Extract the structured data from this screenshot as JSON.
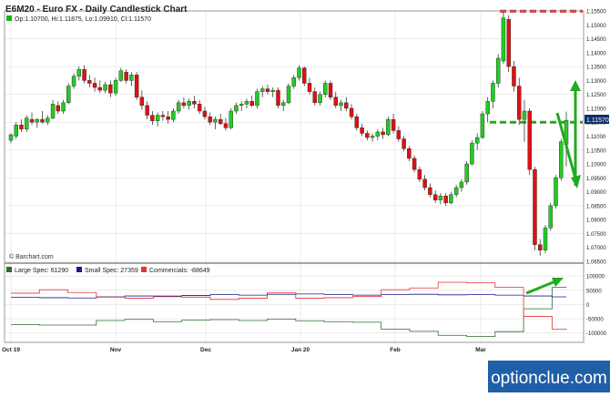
{
  "title": "E6M20 - Euro FX - Daily Candlestick Chart",
  "ohlc": {
    "label": "Op:1.10700, Hi:1.11875, Lo:1.09910, Cl:1.11570",
    "color": "#1db11d"
  },
  "watermark": "© Barchart.com",
  "brand": "optionclue.com",
  "price_tag": "1.11570",
  "colors": {
    "up": "#22cc22",
    "down": "#dd1111",
    "arrow": "#22aa22",
    "large_spec": "#2e6b2e",
    "small_spec": "#1a1a8c",
    "commercials": "#e23333",
    "grid": "#d8d8d8",
    "brand_bg": "#1f5fa8",
    "price_tag_bg": "#0e2f6a"
  },
  "icons": [
    "green-square-icon",
    "navy-square-icon",
    "red-square-icon"
  ],
  "chart_data": [
    {
      "type": "candlestick",
      "title": "E6M20 - Euro FX - Daily Candlestick Chart",
      "x_ticks": [
        "Oct 19",
        "Nov",
        "Dec",
        "Jan 20",
        "Feb",
        "Mar"
      ],
      "ylim": [
        1.065,
        1.155
      ],
      "y_ticks": [
        "1.15500",
        "1.15000",
        "1.14500",
        "1.14000",
        "1.13500",
        "1.13000",
        "1.12500",
        "1.12000",
        "1.11500",
        "1.11000",
        "1.10500",
        "1.10000",
        "1.09500",
        "1.09000",
        "1.08500",
        "1.08000",
        "1.07500",
        "1.07000",
        "1.06500"
      ],
      "reference_lines": [
        {
          "level": 1.1549,
          "style": "dashed",
          "color": "#dd1111"
        },
        {
          "level": 1.115,
          "style": "dashed",
          "color": "#22aa22"
        }
      ],
      "candles": [
        {
          "o": 1.1085,
          "h": 1.111,
          "l": 1.1075,
          "c": 1.1105
        },
        {
          "o": 1.11,
          "h": 1.115,
          "l": 1.109,
          "c": 1.114
        },
        {
          "o": 1.114,
          "h": 1.116,
          "l": 1.1115,
          "c": 1.1125
        },
        {
          "o": 1.1125,
          "h": 1.1175,
          "l": 1.1115,
          "c": 1.1165
        },
        {
          "o": 1.116,
          "h": 1.1185,
          "l": 1.114,
          "c": 1.115
        },
        {
          "o": 1.115,
          "h": 1.1165,
          "l": 1.113,
          "c": 1.116
        },
        {
          "o": 1.116,
          "h": 1.119,
          "l": 1.1145,
          "c": 1.115
        },
        {
          "o": 1.115,
          "h": 1.1175,
          "l": 1.114,
          "c": 1.1165
        },
        {
          "o": 1.1165,
          "h": 1.123,
          "l": 1.116,
          "c": 1.1215
        },
        {
          "o": 1.121,
          "h": 1.1225,
          "l": 1.118,
          "c": 1.119
        },
        {
          "o": 1.119,
          "h": 1.123,
          "l": 1.118,
          "c": 1.122
        },
        {
          "o": 1.122,
          "h": 1.129,
          "l": 1.1215,
          "c": 1.128
        },
        {
          "o": 1.128,
          "h": 1.1325,
          "l": 1.127,
          "c": 1.1315
        },
        {
          "o": 1.1315,
          "h": 1.135,
          "l": 1.13,
          "c": 1.134
        },
        {
          "o": 1.134,
          "h": 1.1355,
          "l": 1.129,
          "c": 1.13
        },
        {
          "o": 1.13,
          "h": 1.132,
          "l": 1.1275,
          "c": 1.129
        },
        {
          "o": 1.129,
          "h": 1.131,
          "l": 1.126,
          "c": 1.1275
        },
        {
          "o": 1.1275,
          "h": 1.13,
          "l": 1.1255,
          "c": 1.1265
        },
        {
          "o": 1.1265,
          "h": 1.1295,
          "l": 1.1255,
          "c": 1.1285
        },
        {
          "o": 1.1285,
          "h": 1.13,
          "l": 1.124,
          "c": 1.1255
        },
        {
          "o": 1.1255,
          "h": 1.131,
          "l": 1.1245,
          "c": 1.13
        },
        {
          "o": 1.13,
          "h": 1.1345,
          "l": 1.1295,
          "c": 1.1335
        },
        {
          "o": 1.133,
          "h": 1.134,
          "l": 1.129,
          "c": 1.13
        },
        {
          "o": 1.13,
          "h": 1.133,
          "l": 1.128,
          "c": 1.132
        },
        {
          "o": 1.132,
          "h": 1.133,
          "l": 1.123,
          "c": 1.124
        },
        {
          "o": 1.124,
          "h": 1.1265,
          "l": 1.1195,
          "c": 1.121
        },
        {
          "o": 1.121,
          "h": 1.1225,
          "l": 1.116,
          "c": 1.1175
        },
        {
          "o": 1.1175,
          "h": 1.119,
          "l": 1.114,
          "c": 1.1155
        },
        {
          "o": 1.1155,
          "h": 1.1185,
          "l": 1.1135,
          "c": 1.1175
        },
        {
          "o": 1.1175,
          "h": 1.119,
          "l": 1.1155,
          "c": 1.117
        },
        {
          "o": 1.117,
          "h": 1.119,
          "l": 1.1145,
          "c": 1.116
        },
        {
          "o": 1.116,
          "h": 1.12,
          "l": 1.115,
          "c": 1.119
        },
        {
          "o": 1.119,
          "h": 1.123,
          "l": 1.118,
          "c": 1.122
        },
        {
          "o": 1.122,
          "h": 1.124,
          "l": 1.12,
          "c": 1.121
        },
        {
          "o": 1.121,
          "h": 1.1235,
          "l": 1.1195,
          "c": 1.1225
        },
        {
          "o": 1.1225,
          "h": 1.1245,
          "l": 1.12,
          "c": 1.1215
        },
        {
          "o": 1.1215,
          "h": 1.123,
          "l": 1.118,
          "c": 1.119
        },
        {
          "o": 1.119,
          "h": 1.1205,
          "l": 1.116,
          "c": 1.117
        },
        {
          "o": 1.117,
          "h": 1.1185,
          "l": 1.114,
          "c": 1.115
        },
        {
          "o": 1.115,
          "h": 1.117,
          "l": 1.1125,
          "c": 1.116
        },
        {
          "o": 1.116,
          "h": 1.118,
          "l": 1.114,
          "c": 1.1145
        },
        {
          "o": 1.1145,
          "h": 1.1165,
          "l": 1.112,
          "c": 1.113
        },
        {
          "o": 1.113,
          "h": 1.12,
          "l": 1.1125,
          "c": 1.119
        },
        {
          "o": 1.119,
          "h": 1.122,
          "l": 1.118,
          "c": 1.121
        },
        {
          "o": 1.121,
          "h": 1.1225,
          "l": 1.119,
          "c": 1.1215
        },
        {
          "o": 1.1215,
          "h": 1.1235,
          "l": 1.12,
          "c": 1.1225
        },
        {
          "o": 1.1225,
          "h": 1.1245,
          "l": 1.1205,
          "c": 1.121
        },
        {
          "o": 1.121,
          "h": 1.127,
          "l": 1.12,
          "c": 1.126
        },
        {
          "o": 1.126,
          "h": 1.128,
          "l": 1.124,
          "c": 1.127
        },
        {
          "o": 1.127,
          "h": 1.1285,
          "l": 1.125,
          "c": 1.126
        },
        {
          "o": 1.126,
          "h": 1.1275,
          "l": 1.124,
          "c": 1.1265
        },
        {
          "o": 1.1265,
          "h": 1.1275,
          "l": 1.12,
          "c": 1.121
        },
        {
          "o": 1.121,
          "h": 1.123,
          "l": 1.119,
          "c": 1.122
        },
        {
          "o": 1.122,
          "h": 1.129,
          "l": 1.1215,
          "c": 1.128
        },
        {
          "o": 1.128,
          "h": 1.132,
          "l": 1.127,
          "c": 1.131
        },
        {
          "o": 1.131,
          "h": 1.1355,
          "l": 1.13,
          "c": 1.1345
        },
        {
          "o": 1.1345,
          "h": 1.135,
          "l": 1.128,
          "c": 1.129
        },
        {
          "o": 1.129,
          "h": 1.131,
          "l": 1.125,
          "c": 1.126
        },
        {
          "o": 1.126,
          "h": 1.1275,
          "l": 1.121,
          "c": 1.122
        },
        {
          "o": 1.122,
          "h": 1.126,
          "l": 1.121,
          "c": 1.125
        },
        {
          "o": 1.125,
          "h": 1.13,
          "l": 1.124,
          "c": 1.129
        },
        {
          "o": 1.129,
          "h": 1.13,
          "l": 1.123,
          "c": 1.124
        },
        {
          "o": 1.124,
          "h": 1.126,
          "l": 1.12,
          "c": 1.121
        },
        {
          "o": 1.121,
          "h": 1.123,
          "l": 1.119,
          "c": 1.122
        },
        {
          "o": 1.122,
          "h": 1.124,
          "l": 1.119,
          "c": 1.12
        },
        {
          "o": 1.12,
          "h": 1.1215,
          "l": 1.116,
          "c": 1.117
        },
        {
          "o": 1.117,
          "h": 1.118,
          "l": 1.112,
          "c": 1.113
        },
        {
          "o": 1.113,
          "h": 1.1145,
          "l": 1.11,
          "c": 1.111
        },
        {
          "o": 1.111,
          "h": 1.112,
          "l": 1.1085,
          "c": 1.1095
        },
        {
          "o": 1.1095,
          "h": 1.111,
          "l": 1.108,
          "c": 1.11
        },
        {
          "o": 1.11,
          "h": 1.1125,
          "l": 1.1085,
          "c": 1.1115
        },
        {
          "o": 1.1115,
          "h": 1.113,
          "l": 1.109,
          "c": 1.1105
        },
        {
          "o": 1.1105,
          "h": 1.117,
          "l": 1.11,
          "c": 1.116
        },
        {
          "o": 1.116,
          "h": 1.118,
          "l": 1.111,
          "c": 1.112
        },
        {
          "o": 1.112,
          "h": 1.1135,
          "l": 1.108,
          "c": 1.109
        },
        {
          "o": 1.109,
          "h": 1.11,
          "l": 1.1045,
          "c": 1.1055
        },
        {
          "o": 1.1055,
          "h": 1.1065,
          "l": 1.101,
          "c": 1.102
        },
        {
          "o": 1.102,
          "h": 1.103,
          "l": 1.097,
          "c": 1.098
        },
        {
          "o": 1.098,
          "h": 1.099,
          "l": 1.0935,
          "c": 1.0945
        },
        {
          "o": 1.0945,
          "h": 1.096,
          "l": 1.0905,
          "c": 1.0915
        },
        {
          "o": 1.0915,
          "h": 1.093,
          "l": 1.088,
          "c": 1.089
        },
        {
          "o": 1.089,
          "h": 1.0905,
          "l": 1.086,
          "c": 1.087
        },
        {
          "o": 1.087,
          "h": 1.0895,
          "l": 1.0855,
          "c": 1.0885
        },
        {
          "o": 1.0885,
          "h": 1.0895,
          "l": 1.085,
          "c": 1.086
        },
        {
          "o": 1.086,
          "h": 1.09,
          "l": 1.0855,
          "c": 1.089
        },
        {
          "o": 1.089,
          "h": 1.0925,
          "l": 1.088,
          "c": 1.0915
        },
        {
          "o": 1.0915,
          "h": 1.0945,
          "l": 1.09,
          "c": 1.0935
        },
        {
          "o": 1.0935,
          "h": 1.101,
          "l": 1.0925,
          "c": 1.1
        },
        {
          "o": 1.1,
          "h": 1.1085,
          "l": 1.0995,
          "c": 1.1075
        },
        {
          "o": 1.1075,
          "h": 1.111,
          "l": 1.105,
          "c": 1.1095
        },
        {
          "o": 1.1095,
          "h": 1.119,
          "l": 1.109,
          "c": 1.118
        },
        {
          "o": 1.118,
          "h": 1.124,
          "l": 1.115,
          "c": 1.1225
        },
        {
          "o": 1.1225,
          "h": 1.13,
          "l": 1.12,
          "c": 1.129
        },
        {
          "o": 1.129,
          "h": 1.1395,
          "l": 1.1275,
          "c": 1.138
        },
        {
          "o": 1.137,
          "h": 1.155,
          "l": 1.136,
          "c": 1.1525
        },
        {
          "o": 1.152,
          "h": 1.1535,
          "l": 1.133,
          "c": 1.135
        },
        {
          "o": 1.135,
          "h": 1.137,
          "l": 1.126,
          "c": 1.128
        },
        {
          "o": 1.128,
          "h": 1.131,
          "l": 1.114,
          "c": 1.116
        },
        {
          "o": 1.116,
          "h": 1.123,
          "l": 1.108,
          "c": 1.119
        },
        {
          "o": 1.119,
          "h": 1.12,
          "l": 1.096,
          "c": 1.098
        },
        {
          "o": 1.098,
          "h": 1.099,
          "l": 1.069,
          "c": 1.071
        },
        {
          "o": 1.071,
          "h": 1.073,
          "l": 1.067,
          "c": 1.069
        },
        {
          "o": 1.069,
          "h": 1.078,
          "l": 1.068,
          "c": 1.077
        },
        {
          "o": 1.077,
          "h": 1.086,
          "l": 1.076,
          "c": 1.085
        },
        {
          "o": 1.085,
          "h": 1.096,
          "l": 1.084,
          "c": 1.095
        },
        {
          "o": 1.095,
          "h": 1.109,
          "l": 1.094,
          "c": 1.108
        },
        {
          "o": 1.107,
          "h": 1.1188,
          "l": 1.0991,
          "c": 1.1157
        }
      ]
    },
    {
      "type": "line",
      "step": true,
      "ylim": [
        -120000,
        110000
      ],
      "y_ticks": [
        100000,
        50000,
        0,
        -50000,
        -100000
      ],
      "series": [
        {
          "name": "Large Spec: 61290",
          "values": [
            -70000,
            -70000,
            -72000,
            -72000,
            -72000,
            -72000,
            -56000,
            -56000,
            -52000,
            -52000,
            -60000,
            -60000,
            -55000,
            -55000,
            -53000,
            -53000,
            -56000,
            -56000,
            -51000,
            -51000,
            -57000,
            -57000,
            -60000,
            -60000,
            -62000,
            -62000,
            -86000,
            -86000,
            -94000,
            -94000,
            -108000,
            -108000,
            -112000,
            -112000,
            -95000,
            -95000,
            -15000,
            -15000,
            60000,
            61290
          ]
        },
        {
          "name": "Small Spec: 27359",
          "values": [
            25000,
            25000,
            24000,
            24000,
            23000,
            23000,
            27000,
            27000,
            30000,
            30000,
            28000,
            28000,
            32000,
            32000,
            35000,
            35000,
            33000,
            33000,
            36000,
            36000,
            37000,
            37000,
            35000,
            35000,
            33000,
            33000,
            35000,
            35000,
            36000,
            36000,
            34000,
            34000,
            35000,
            35000,
            33000,
            33000,
            30000,
            30000,
            27000,
            27359
          ]
        },
        {
          "name": "Commercials: -88649",
          "values": [
            40000,
            40000,
            52000,
            52000,
            42000,
            42000,
            26000,
            26000,
            22000,
            22000,
            30000,
            30000,
            26000,
            26000,
            18000,
            18000,
            22000,
            22000,
            42000,
            42000,
            22000,
            22000,
            24000,
            24000,
            28000,
            28000,
            52000,
            52000,
            58000,
            58000,
            78000,
            78000,
            76000,
            76000,
            60000,
            60000,
            -42000,
            -42000,
            -86000,
            -88649
          ]
        }
      ]
    }
  ]
}
